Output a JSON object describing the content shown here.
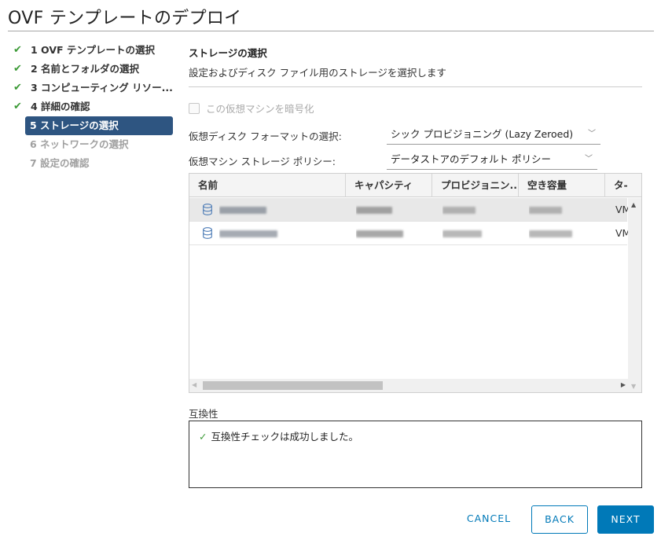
{
  "dialog": {
    "title": "OVF テンプレートのデプロイ"
  },
  "steps": [
    {
      "label": "1 OVF テンプレートの選択",
      "state": "done"
    },
    {
      "label": "2 名前とフォルダの選択",
      "state": "done"
    },
    {
      "label": "3 コンピューティング リソー...",
      "state": "done"
    },
    {
      "label": "4 詳細の確認",
      "state": "done"
    },
    {
      "label": "5 ストレージの選択",
      "state": "active"
    },
    {
      "label": "6 ネットワークの選択",
      "state": "pending"
    },
    {
      "label": "7 設定の確認",
      "state": "pending"
    }
  ],
  "storage": {
    "title": "ストレージの選択",
    "description": "設定およびディスク ファイル用のストレージを選択します",
    "encrypt_label": "この仮想マシンを暗号化",
    "disk_format_label": "仮想ディスク フォーマットの選択:",
    "disk_format_value": "シック プロビジョニング (Lazy Zeroed)",
    "policy_label": "仮想マシン ストレージ ポリシー:",
    "policy_value": "データストアのデフォルト ポリシー"
  },
  "table": {
    "headers": [
      "名前",
      "キャパシティ",
      "プロビジョニン...",
      "空き容量",
      "タ-"
    ],
    "rows": [
      {
        "type": "VM"
      },
      {
        "type": "VM"
      }
    ]
  },
  "compatibility": {
    "label": "互換性",
    "message": "互換性チェックは成功しました。"
  },
  "buttons": {
    "cancel": "CANCEL",
    "back": "BACK",
    "next": "NEXT"
  },
  "colors": {
    "accent": "#0079b8",
    "active_step": "#2e5581",
    "success": "#3c9a37"
  },
  "icons": {
    "done": "check-icon",
    "datastore": "datastore-icon"
  }
}
